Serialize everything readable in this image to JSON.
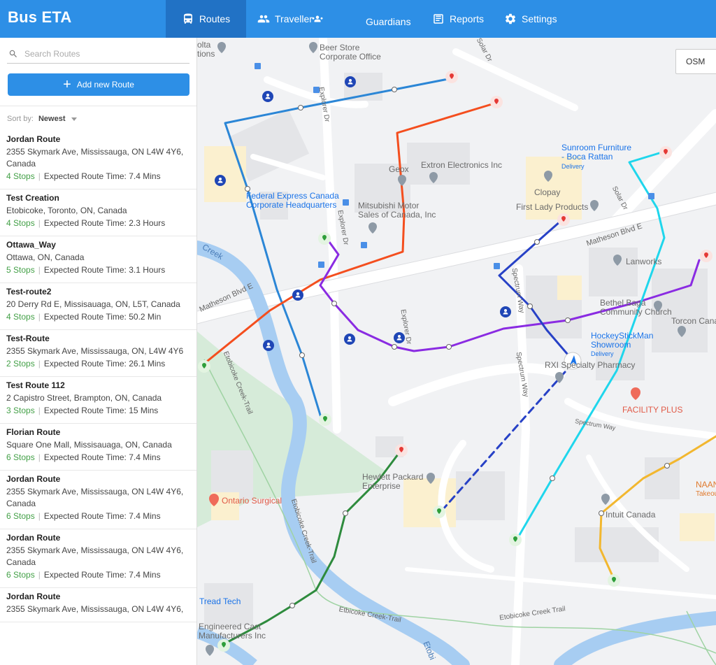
{
  "app": {
    "title": "Bus ETA"
  },
  "nav": {
    "routes": "Routes",
    "traveller": "Traveller",
    "guardians": "Guardians",
    "reports": "Reports",
    "settings": "Settings"
  },
  "sidebar": {
    "search_placeholder": "Search Routes",
    "add_button": "Add new Route",
    "sort_label": "Sort by:",
    "sort_value": "Newest",
    "expected_prefix": "Expected Route Time: ",
    "routes": [
      {
        "name": "Jordan Route",
        "address": "2355 Skymark Ave, Mississauga, ON L4W 4Y6, Canada",
        "stops": "4 Stops",
        "time": "7.4 Mins"
      },
      {
        "name": "Test Creation",
        "address": "Etobicoke, Toronto, ON, Canada",
        "stops": "4 Stops",
        "time": "2.3 Hours"
      },
      {
        "name": "Ottawa_Way",
        "address": "Ottawa, ON, Canada",
        "stops": "5 Stops",
        "time": "3.1 Hours"
      },
      {
        "name": "Test-route2",
        "address": "20 Derry Rd E, Missisauaga, ON, L5T, Canada",
        "stops": "4 Stops",
        "time": "50.2 Min"
      },
      {
        "name": "Test-Route",
        "address": "2355 Skymark Ave, Mississauga, ON, L4W 4Y6",
        "stops": "2 Stops",
        "time": "26.1 Mins"
      },
      {
        "name": "Test Route 112",
        "address": "2 Capistro Street, Brampton, ON, Canada",
        "stops": "3 Stops",
        "time": "15 Mins"
      },
      {
        "name": "Florian Route",
        "address": "Square One Mall, Missisauaga, ON, Canada",
        "stops": "6 Stops",
        "time": "7.4 Mins"
      },
      {
        "name": "Jordan Route",
        "address": "2355 Skymark Ave, Mississauga, ON L4W 4Y6, Canada",
        "stops": "6 Stops",
        "time": "7.4 Mins"
      },
      {
        "name": "Jordan Route",
        "address": "2355 Skymark Ave, Mississauga, ON L4W 4Y6, Canada",
        "stops": "6 Stops",
        "time": "7.4 Mins"
      },
      {
        "name": "Jordan Route",
        "address": "2355 Skymark Ave, Mississauga, ON L4W 4Y6,",
        "stops": "",
        "time": ""
      }
    ]
  },
  "map": {
    "layer_button": "OSM",
    "labels": {
      "beer_store": "Beer Store\nCorporate Office",
      "olta": "olta\ntions",
      "federal_express": "Federal Express Canada\nCorporate Headquarters",
      "geox": "Geox",
      "extron": "Extron Electronics Inc",
      "mitsubishi": "Mitsubishi Motor\nSales of Canada, Inc",
      "sunroom": "Sunroom Furniture\n- Boca Rattan",
      "delivery1": "Delivery",
      "clopay": "Clopay",
      "first_lady": "First Lady Products",
      "lanworks": "Lanworks",
      "bethel": "Bethel Baga\nCommunity Church",
      "torcon": "Torcon Cana",
      "hockey": "HockeyStickMan\nShowroom",
      "delivery2": "Delivery",
      "rxi": "RXI Specialty Pharmacy",
      "facility": "FACILITY PLUS",
      "hewlett": "Hewlett Packard\nEnterprise",
      "ontario_surgical": "Ontario Surgical",
      "intuit": "Intuit Canada",
      "naan": "NAAN",
      "takeout": "Takeou",
      "tread": "Tread Tech",
      "engineered": "Engineered Cast\nManufacturers Inc",
      "creek": "Creek",
      "etobi": "Etobi"
    },
    "streets": {
      "matheson_w": "Matheson Blvd E",
      "matheson_e": "Matheson Blvd E",
      "explorer1": "Explorer Dr",
      "explorer2": "Explorer Dr",
      "explorer3": "Explorer Dr",
      "solar1": "Solar Dr",
      "solar2": "Solar Dr",
      "spectrum1": "Spectrum Way",
      "spectrum2": "Spectrum Way",
      "spectrum3": "Spectrum Way",
      "trail1": "Etobicoke Creek-Trail",
      "trail2": "Etobicoke Creek-Trail",
      "trail3": "Etbicoke Creek-Trail",
      "trail4": "Etobicoke Creek Trail",
      "trail5": "Etobicoke Creek-Trail"
    },
    "route_colors": [
      "#2b86d6",
      "#f44e1e",
      "#8a2be2",
      "#2741c6",
      "#1fd6ec",
      "#f2b72f",
      "#2e8b3d"
    ]
  }
}
